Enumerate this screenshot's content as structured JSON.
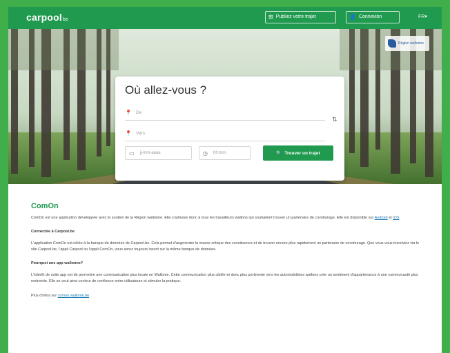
{
  "header": {
    "logo": "carpool",
    "logo_suffix": "be",
    "publish_label": "Publiez votre trajet",
    "login_label": "Connexion",
    "lang": "FR▾"
  },
  "hero": {
    "badge_text": "Région wallonne"
  },
  "search": {
    "title": "Où allez-vous ?",
    "from_placeholder": "De",
    "to_placeholder": "Vers",
    "date_placeholder": "jj-mm-aaaa",
    "time_placeholder": "hh:mm",
    "submit_label": "Trouver un trajet"
  },
  "content": {
    "title": "ComOn",
    "intro_text": "ComOn est une application développée avec le soutien de la Région wallonne. Elle s'adresse donc à tous les travailleurs wallons qui souhaitent trouver un partenaire de covoiturage. Elle est disponible sur",
    "android": "Android",
    "et": " et ",
    "ios": "iOS",
    "intro_end": ".",
    "section1_title": "Connectée à Carpool.be",
    "section1_text": "L'application ComOn est reliée à la banque de données de Carpool.be. Cela permet d'augmenter la masse critique des covoitureurs et de trouver encore plus rapidement un partenaire de covoiturage. Que vous vous inscriviez via le site Carpool.be, l'appli Carpool ou l'appli ComOn, vous serez toujours inscrit sur la même banque de données.",
    "section2_title": "Pourquoi une app wallonne?",
    "section2_text": "L'intérêt de cette app est de permettre une communication plus locale en Wallonie. Cette communication plus ciblée et donc plus pertinente vers les automobilistes wallons crée un sentiment d'appartenance à une communauté plus restreinte. Elle se veut ainsi vecteur de confiance entre utilisateurs et stimuler la pratique.",
    "more_prefix": "Plus d'infos sur",
    "more_link": "comon.wallonie.be"
  },
  "colors": {
    "brand_green": "#1f9a4f",
    "page_bg": "#3fae4b",
    "link_blue": "#1f7bb8"
  }
}
